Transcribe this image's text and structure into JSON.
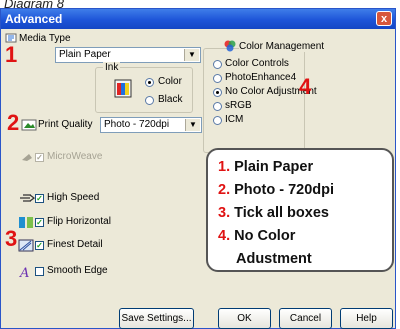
{
  "caption": "Diagram 8",
  "window": {
    "title": "Advanced",
    "close_label": "x"
  },
  "media_type": {
    "label": "Media Type",
    "value": "Plain Paper"
  },
  "ink": {
    "label": "Ink",
    "options": [
      {
        "label": "Color",
        "selected": true
      },
      {
        "label": "Black",
        "selected": false
      }
    ]
  },
  "print_quality": {
    "label": "Print Quality",
    "value": "Photo - 720dpi"
  },
  "checkboxes": [
    {
      "label": "MicroWeave",
      "checked": true,
      "enabled": false
    },
    {
      "label": "High Speed",
      "checked": true,
      "enabled": true
    },
    {
      "label": "Flip Horizontal",
      "checked": true,
      "enabled": true
    },
    {
      "label": "Finest Detail",
      "checked": true,
      "enabled": true
    },
    {
      "label": "Smooth Edge",
      "checked": false,
      "enabled": true
    }
  ],
  "color_management": {
    "label": "Color Management",
    "options": [
      {
        "label": "Color Controls",
        "selected": false
      },
      {
        "label": "PhotoEnhance4",
        "selected": false
      },
      {
        "label": "No Color Adjustment",
        "selected": true
      },
      {
        "label": "sRGB",
        "selected": false
      },
      {
        "label": "ICM",
        "selected": false
      }
    ]
  },
  "markers": [
    "1",
    "2",
    "3",
    "4"
  ],
  "callout": {
    "items": [
      {
        "num": "1.",
        "text": "Plain Paper"
      },
      {
        "num": "2.",
        "text": "Photo - 720dpi"
      },
      {
        "num": "3.",
        "text": "Tick all boxes"
      },
      {
        "num": "4.",
        "text": "No Color"
      }
    ],
    "continuation": "Adustment"
  },
  "buttons": {
    "save": "Save Settings...",
    "ok": "OK",
    "cancel": "Cancel",
    "help": "Help"
  },
  "colors": {
    "titlebar": "#1d54d8",
    "dialog_bg": "#ece9d8",
    "annotation_red": "#e01313"
  }
}
